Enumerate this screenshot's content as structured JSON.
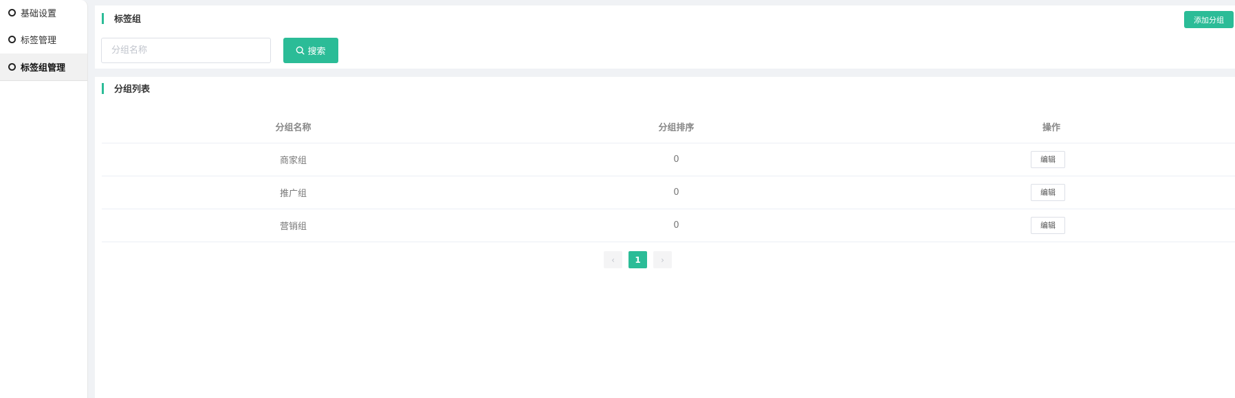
{
  "sidebar": {
    "items": [
      {
        "label": "基础设置",
        "active": false
      },
      {
        "label": "标签管理",
        "active": false
      },
      {
        "label": "标签组管理",
        "active": true
      }
    ]
  },
  "filter_section": {
    "title": "标签组",
    "add_button": "添加分组",
    "search_placeholder": "分组名称",
    "search_value": "",
    "search_button": "搜索"
  },
  "list_section": {
    "title": "分组列表",
    "columns": [
      "分组名称",
      "分组排序",
      "操作"
    ],
    "rows": [
      {
        "name": "商家组",
        "sort": "0",
        "action": "编辑"
      },
      {
        "name": "推广组",
        "sort": "0",
        "action": "编辑"
      },
      {
        "name": "营销组",
        "sort": "0",
        "action": "编辑"
      }
    ]
  },
  "pagination": {
    "prev": "‹",
    "current_page": "1",
    "next": "›"
  },
  "colors": {
    "accent": "#2bbc97",
    "background": "#f0f2f5"
  }
}
